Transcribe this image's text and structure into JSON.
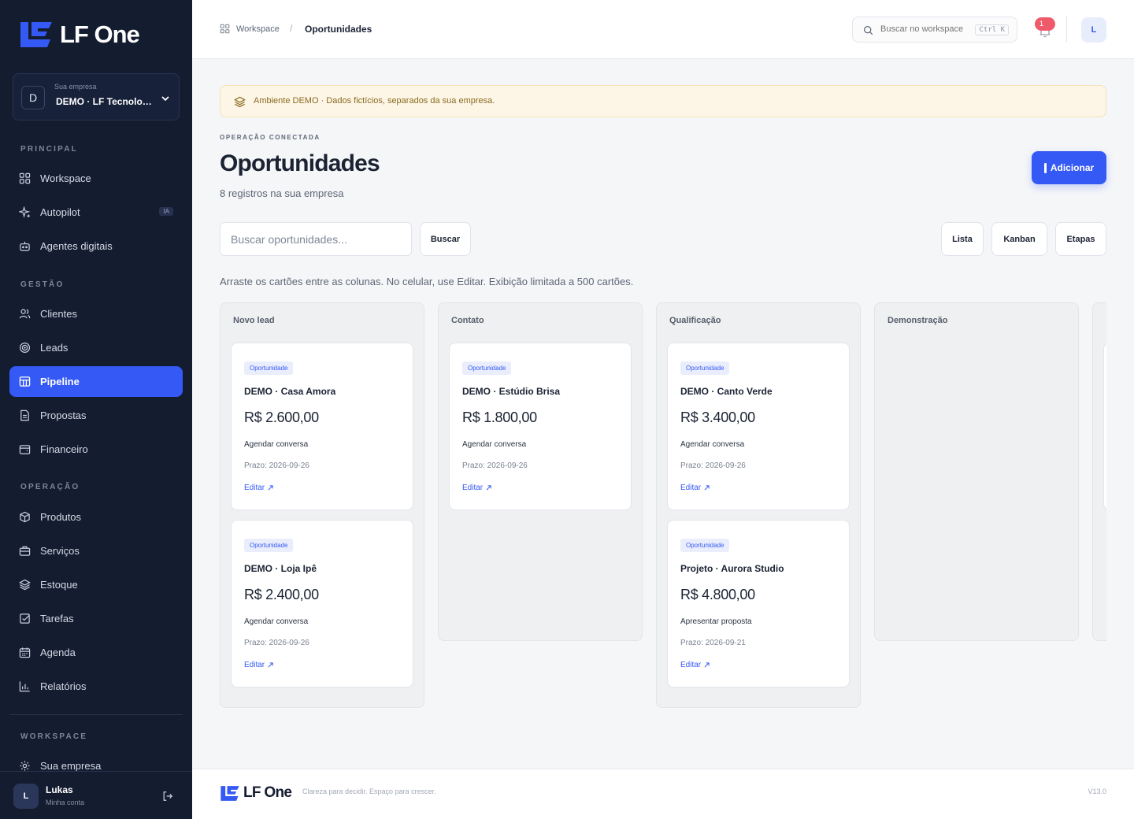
{
  "brand": {
    "name": "LF One",
    "accent": "#3559f5",
    "sidebar_bg": "#141c30"
  },
  "sidebar": {
    "company_label": "Sua empresa",
    "company_name": "DEMO · LF Tecnologia",
    "company_initial": "D",
    "sections": {
      "principal": "PRINCIPAL",
      "gestao": "GESTÃO",
      "operacao": "OPERAÇÃO",
      "workspace": "WORKSPACE"
    },
    "items": [
      {
        "label": "Workspace",
        "icon": "grid-icon"
      },
      {
        "label": "Autopilot",
        "icon": "sparkle-icon",
        "badge": "IA"
      },
      {
        "label": "Agentes digitais",
        "icon": "bot-icon"
      },
      {
        "label": "Clientes",
        "icon": "users-icon"
      },
      {
        "label": "Leads",
        "icon": "target-icon"
      },
      {
        "label": "Pipeline",
        "icon": "kanban-icon",
        "active": true
      },
      {
        "label": "Propostas",
        "icon": "document-icon"
      },
      {
        "label": "Financeiro",
        "icon": "wallet-icon"
      },
      {
        "label": "Produtos",
        "icon": "box-icon"
      },
      {
        "label": "Serviços",
        "icon": "briefcase-icon"
      },
      {
        "label": "Estoque",
        "icon": "layers-icon"
      },
      {
        "label": "Tarefas",
        "icon": "checklist-icon"
      },
      {
        "label": "Agenda",
        "icon": "calendar-icon"
      },
      {
        "label": "Relatórios",
        "icon": "bar-chart-icon"
      },
      {
        "label": "Sua empresa",
        "icon": "gear-icon"
      }
    ],
    "user": {
      "initial": "L",
      "name": "Lukas",
      "subtitle": "Minha conta"
    }
  },
  "topbar": {
    "breadcrumb_home": "Workspace",
    "breadcrumb_sep": "/",
    "breadcrumb_current": "Oportunidades",
    "search_placeholder": "Buscar no workspace",
    "search_shortcut": "Ctrl K",
    "notification_count": "1",
    "avatar_initial": "L"
  },
  "banner": {
    "text": "Ambiente DEMO · Dados fictícios, separados da sua empresa."
  },
  "page": {
    "eyebrow": "OPERAÇÃO CONECTADA",
    "title": "Oportunidades",
    "subtitle": "8 registros na sua empresa",
    "add_label": "Adicionar",
    "search_placeholder": "Buscar oportunidades...",
    "search_button": "Buscar",
    "views": [
      "Lista",
      "Kanban",
      "Etapas"
    ],
    "hint": "Arraste os cartões entre as colunas. No celular, use Editar. Exibição limitada a 500 cartões."
  },
  "board": {
    "columns": [
      {
        "title": "Novo lead",
        "cards": [
          {
            "tag": "Oportunidade",
            "title": "DEMO · Casa Amora",
            "value": "R$ 2.600,00",
            "next": "Agendar conversa",
            "due": "Prazo: 2026-09-26",
            "edit": "Editar"
          },
          {
            "tag": "Oportunidade",
            "title": "DEMO · Loja Ipê",
            "value": "R$ 2.400,00",
            "next": "Agendar conversa",
            "due": "Prazo: 2026-09-26",
            "edit": "Editar"
          }
        ]
      },
      {
        "title": "Contato",
        "cards": [
          {
            "tag": "Oportunidade",
            "title": "DEMO · Estúdio Brisa",
            "value": "R$ 1.800,00",
            "next": "Agendar conversa",
            "due": "Prazo: 2026-09-26",
            "edit": "Editar"
          }
        ]
      },
      {
        "title": "Qualificação",
        "cards": [
          {
            "tag": "Oportunidade",
            "title": "DEMO · Canto Verde",
            "value": "R$ 3.400,00",
            "next": "Agendar conversa",
            "due": "Prazo: 2026-09-26",
            "edit": "Editar"
          },
          {
            "tag": "Oportunidade",
            "title": "Projeto · Aurora Studio",
            "value": "R$ 4.800,00",
            "next": "Apresentar proposta",
            "due": "Prazo: 2026-09-21",
            "edit": "Editar"
          }
        ]
      },
      {
        "title": "Demonstração",
        "cards": []
      }
    ]
  },
  "footer": {
    "logo_text": "LF One",
    "tagline": "Clareza para decidir. Espaço para crescer.",
    "version": "V13.0"
  }
}
